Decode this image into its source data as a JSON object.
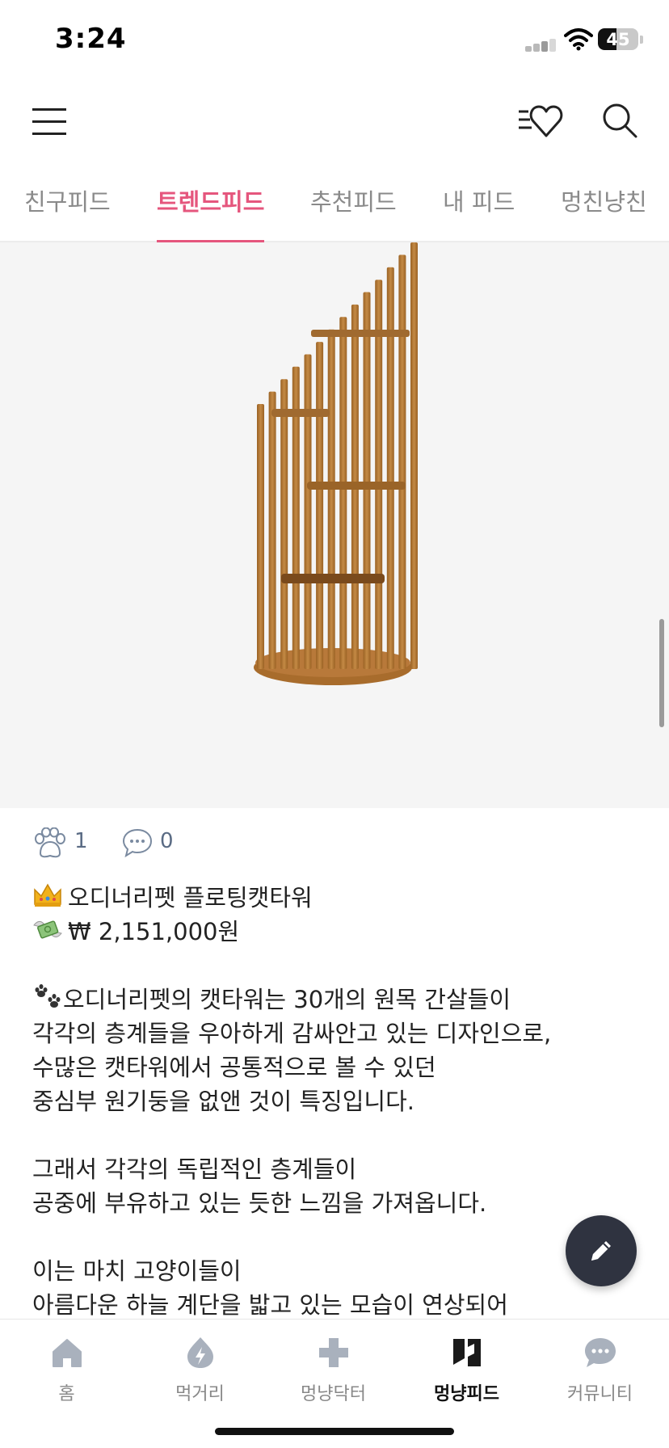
{
  "status_bar": {
    "time": "3:24",
    "battery": "45",
    "battery_level": 0.45
  },
  "header": {
    "menu_icon": "hamburger-menu-icon",
    "wishlist_icon": "heart-list-icon",
    "search_icon": "search-icon"
  },
  "tabs": [
    {
      "label": "친구피드",
      "active": false
    },
    {
      "label": "트렌드피드",
      "active": true
    },
    {
      "label": "추천피드",
      "active": false
    },
    {
      "label": "내 피드",
      "active": false
    },
    {
      "label": "멍친냥친",
      "active": false
    }
  ],
  "post": {
    "image_subject": "wooden-cat-tower-icon",
    "reactions": {
      "paw_count": "1",
      "comment_count": "0"
    },
    "title": "오디너리펫 플로팅캣타워",
    "price": "₩ 2,151,000원",
    "body": [
      "오디너리펫의 캣타워는 30개의 원목 간살들이",
      "각각의 층계들을 우아하게 감싸안고 있는 디자인으로,",
      "수많은 캣타워에서 공통적으로 볼 수 있던",
      "중심부 원기둥을 없앤 것이 특징입니다.",
      "",
      "그래서 각각의 독립적인 층계들이",
      "공중에 부유하고 있는 듯한 느낌을 가져옵니다.",
      "",
      "이는 마치 고양이들이",
      "아름다운 하늘 계단을 밟고 있는 모습이 연상되어"
    ]
  },
  "bottom_nav": [
    {
      "label": "홈",
      "icon": "home-icon",
      "active": false
    },
    {
      "label": "먹거리",
      "icon": "food-icon",
      "active": false
    },
    {
      "label": "멍냥닥터",
      "icon": "doctor-cross-icon",
      "active": false
    },
    {
      "label": "멍냥피드",
      "icon": "feed-icon",
      "active": true
    },
    {
      "label": "커뮤니티",
      "icon": "chat-bubble-icon",
      "active": false
    }
  ],
  "colors": {
    "accent": "#e5567d",
    "fab": "#2f3340",
    "count_text": "#5a6b84"
  }
}
